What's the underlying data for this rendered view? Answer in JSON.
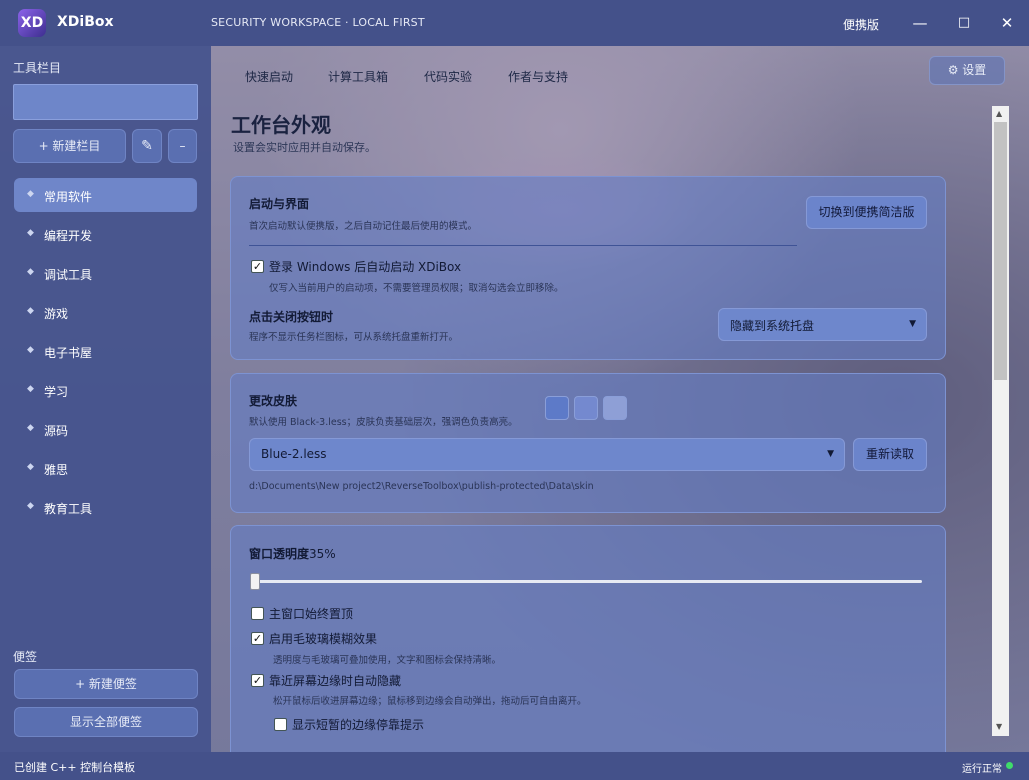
{
  "window": {
    "app_name": "XDiBox",
    "logo_text": "XD",
    "subtitle": "SECURITY WORKSPACE · LOCAL FIRST",
    "edition": "便携版",
    "minimize": "—",
    "maximize": "□",
    "close": "✕"
  },
  "sidebar": {
    "heading": "工具栏目",
    "input_value": "",
    "new_column": "+ 新建栏目",
    "edit_icon": "✎",
    "remove": "–",
    "items": [
      {
        "label": "常用软件",
        "active": true
      },
      {
        "label": "编程开发"
      },
      {
        "label": "调试工具"
      },
      {
        "label": "游戏"
      },
      {
        "label": "电子书屋"
      },
      {
        "label": "学习"
      },
      {
        "label": "源码"
      },
      {
        "label": "雅思"
      },
      {
        "label": "教育工具"
      }
    ],
    "item_icon": "◆",
    "notes_heading": "便签",
    "new_note": "+ 新建便签",
    "show_notes": "显示全部便签"
  },
  "tabs": [
    "快速启动",
    "计算工具箱",
    "代码实验",
    "作者与支持"
  ],
  "settings_button": "设置",
  "settings_icon": "gear-icon",
  "page": {
    "title": "工作台外观",
    "subtitle": "设置会实时应用并自动保存。"
  },
  "startup": {
    "title": "启动与界面",
    "desc": "首次启动默认便携版，之后自动记住最后使用的模式。",
    "switch_button": "切换到便携简洁版",
    "autostart_label": "登录 Windows 后自动启动 XDiBox",
    "autostart_checked": true,
    "autostart_desc": "仅写入当前用户的启动项，不需要管理员权限；取消勾选会立即移除。",
    "close_title": "点击关闭按钮时",
    "close_desc": "程序不显示任务栏图标，可从系统托盘重新打开。",
    "close_option": "隐藏到系统托盘"
  },
  "skin": {
    "title": "更改皮肤",
    "desc": "默认使用 Black-3.less；皮肤负责基础层次，强调色负责高亮。",
    "swatch_colors": [
      "#5d7ac8",
      "#7489cf",
      "#8e9fd6"
    ],
    "selected": "Blue-2.less",
    "reload_button": "重新读取",
    "path": "d:\\Documents\\New project2\\ReverseToolbox\\publish-protected\\Data\\skin"
  },
  "opacity": {
    "title": "窗口透明度",
    "value_text": "35%",
    "value": 0.0,
    "always_top_label": "主窗口始终置顶",
    "always_top_checked": false,
    "blur_label": "启用毛玻璃模糊效果",
    "blur_checked": true,
    "blur_desc": "透明度与毛玻璃可叠加使用，文字和图标会保持清晰。",
    "autohide_label": "靠近屏幕边缘时自动隐藏",
    "autohide_checked": true,
    "autohide_desc": "松开鼠标后收进屏幕边缘；鼠标移到边缘会自动弹出，拖动后可自由离开。",
    "edge_hint_label": "显示短暂的边缘停靠提示",
    "edge_hint_checked": false
  },
  "statusbar": {
    "left": "已创建 C++ 控制台模板",
    "right": "运行正常"
  },
  "colors": {
    "chrome": "#44518a",
    "accent": "#6f86c9",
    "status_ok": "#3fdc6a"
  }
}
